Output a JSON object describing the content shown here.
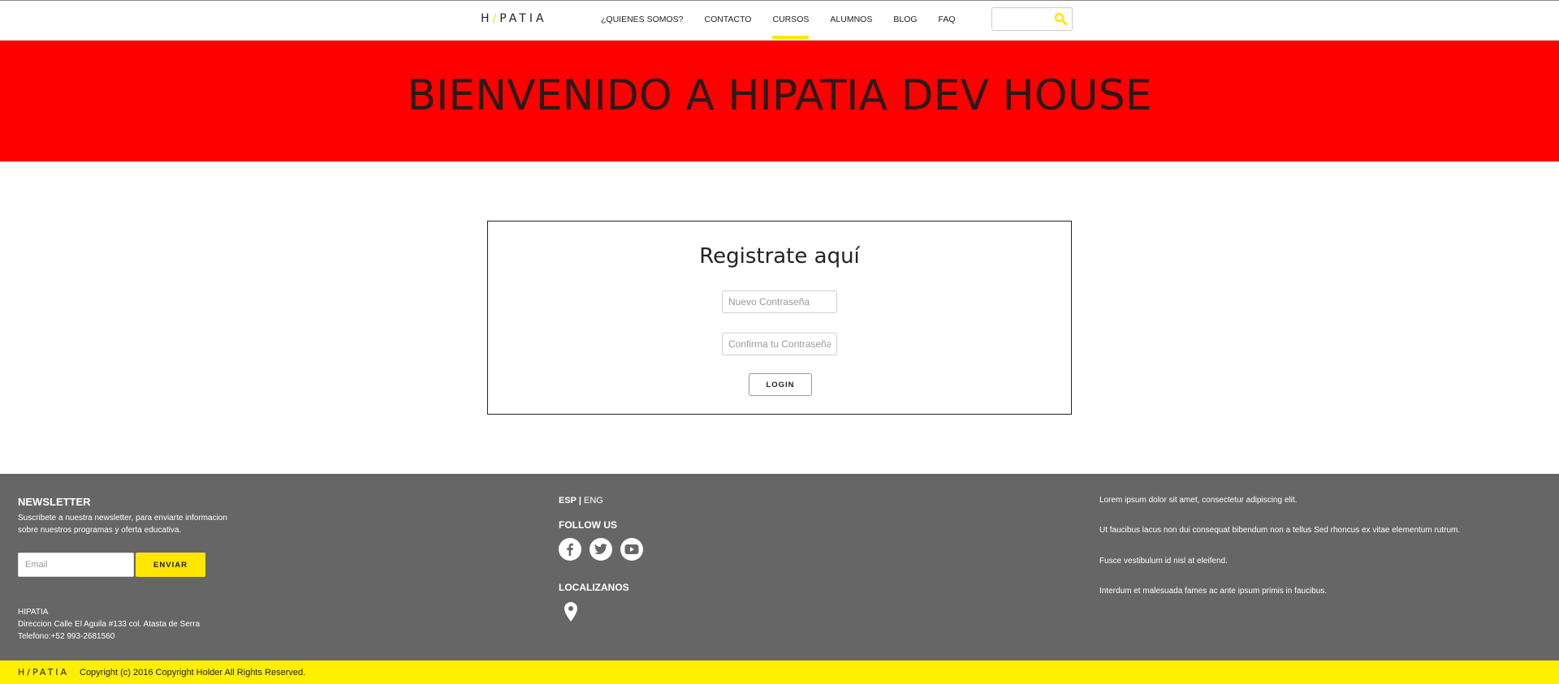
{
  "navbar": {
    "logo_left": "H",
    "logo_slash": "/",
    "logo_right": "PATIA",
    "items": [
      {
        "label": "¿QUIENES SOMOS?"
      },
      {
        "label": "CONTACTO"
      },
      {
        "label": "CURSOS"
      },
      {
        "label": "ALUMNOS"
      },
      {
        "label": "BLOG"
      },
      {
        "label": "FAQ"
      }
    ],
    "active_item": "CURSOS",
    "search_placeholder": ""
  },
  "hero": {
    "title": "BIENVENIDO A HIPATIA DEV HOUSE",
    "background": "#ff0000"
  },
  "register": {
    "title": "Registrate aquí",
    "new_password_placeholder": "Nuevo Contraseña",
    "confirm_password_placeholder": "Confirma tu Contraseña",
    "button_label": "LOGIN"
  },
  "footer": {
    "newsletter_title": "NEWSLETTER",
    "newsletter_desc": "Suscribete a nuestra newsletter, para enviarte informacion sobre nuestros programas y oferta educativa.",
    "email_placeholder": "Email",
    "send_label": "ENVIAR",
    "address_name": "HIPATIA",
    "address_line": "Direccion Calle El Aguila #133 col. Atasta de Serra",
    "address_phone": "Telefono:+52 993-2681560",
    "lang_esp": "ESP",
    "lang_sep": " | ",
    "lang_eng": "ENG",
    "follow_title": "FOLLOW US",
    "social_icons": [
      "facebook-icon",
      "twitter-icon",
      "youtube-icon"
    ],
    "locate_title": "LOCALIZANOS",
    "lorem": [
      "Lorem ipsum dolor sit amet, consectetur adipiscing elit.",
      "Ut faucibus lacus non dui consequat bibendum non a tellus Sed rhoncus ex vitae elementum rutrum.",
      "Fusce vestibulum id nisl at eleifend.",
      "Interdum et malesuada fames ac ante ipsum primis in faucibus."
    ],
    "background": "#666666"
  },
  "bottom_bar": {
    "logo": "H/PATIA",
    "copyright": "Copyright (c) 2016 Copyright Holder All Rights Reserved.",
    "background": "#ffef00"
  },
  "colors": {
    "accent_yellow": "#ffe600"
  }
}
